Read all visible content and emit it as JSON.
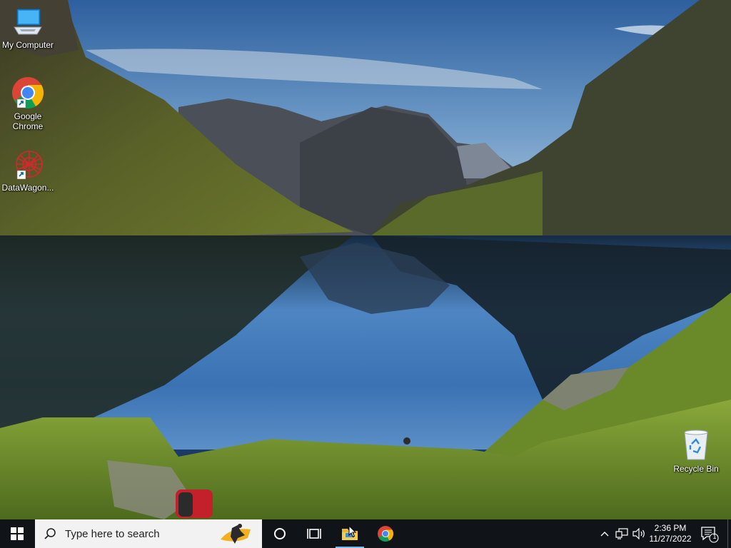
{
  "desktop": {
    "icons": [
      {
        "label": "My Computer",
        "icon": "my-computer-icon"
      },
      {
        "label": "Google\nChrome",
        "icon": "google-chrome-icon"
      },
      {
        "label": "DataWagon...",
        "icon": "datawagon-icon"
      },
      {
        "label": "Recycle Bin",
        "icon": "recycle-bin-icon"
      }
    ]
  },
  "taskbar": {
    "search_placeholder": "Type here to search",
    "pinned": [
      "file-explorer-icon",
      "google-chrome-icon"
    ],
    "clock_time": "2:36 PM",
    "clock_date": "11/27/2022",
    "notification_count": "1"
  },
  "colors": {
    "taskbar": "#101418",
    "search_box": "#f2f2f2",
    "active_indicator": "#76b9ed"
  }
}
